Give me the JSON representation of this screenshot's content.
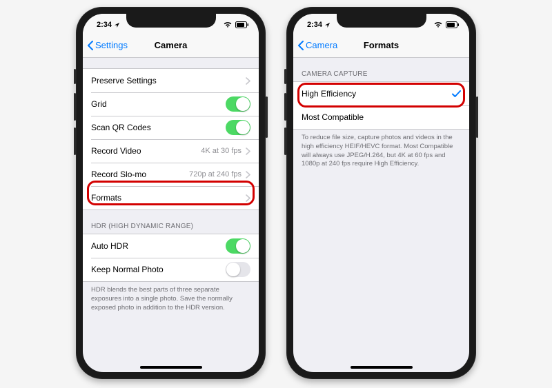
{
  "status": {
    "time": "2:34",
    "loc_glyph": "↗",
    "wifi_glyph": "⋮",
    "batt_glyph": "▮"
  },
  "left_phone": {
    "nav": {
      "back": "Settings",
      "title": "Camera"
    },
    "rows": {
      "preserve": "Preserve Settings",
      "grid": "Grid",
      "scanqr": "Scan QR Codes",
      "record_video": "Record Video",
      "record_video_detail": "4K at 30 fps",
      "record_slomo": "Record Slo-mo",
      "record_slomo_detail": "720p at 240 fps",
      "formats": "Formats"
    },
    "hdr_header": "HDR (HIGH DYNAMIC RANGE)",
    "hdr": {
      "auto": "Auto HDR",
      "keep": "Keep Normal Photo"
    },
    "hdr_footer": "HDR blends the best parts of three separate exposures into a single photo. Save the normally exposed photo in addition to the HDR version."
  },
  "right_phone": {
    "nav": {
      "back": "Camera",
      "title": "Formats"
    },
    "capture_header": "CAMERA CAPTURE",
    "rows": {
      "highEff": "High Efficiency",
      "mostComp": "Most Compatible"
    },
    "footer": "To reduce file size, capture photos and videos in the high efficiency HEIF/HEVC format. Most Compatible will always use JPEG/H.264, but 4K at 60 fps and 1080p at 240 fps require High Efficiency."
  }
}
